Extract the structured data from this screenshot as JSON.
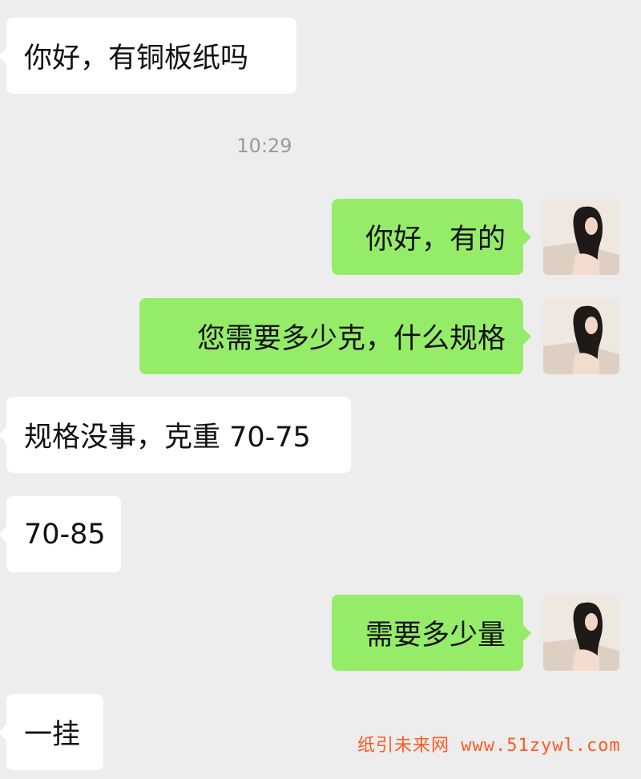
{
  "messages": [
    {
      "side": "in",
      "text": "你好，有铜板纸吗"
    },
    {
      "side": "out",
      "text": "你好，有的"
    },
    {
      "side": "out",
      "text": "您需要多少克，什么规格"
    },
    {
      "side": "in",
      "text": "规格没事，克重 70-75"
    },
    {
      "side": "in",
      "text": "70-85"
    },
    {
      "side": "out",
      "text": "需要多少量"
    },
    {
      "side": "in",
      "text": "一挂"
    }
  ],
  "timestamp": "10:29",
  "watermark": "纸引未来网 www.51zywl.com",
  "colors": {
    "background": "#ededed",
    "incoming_bubble": "#ffffff",
    "outgoing_bubble": "#95ec69",
    "watermark": "#ff5a22"
  },
  "icons": {
    "avatar": "user-avatar-photo"
  }
}
